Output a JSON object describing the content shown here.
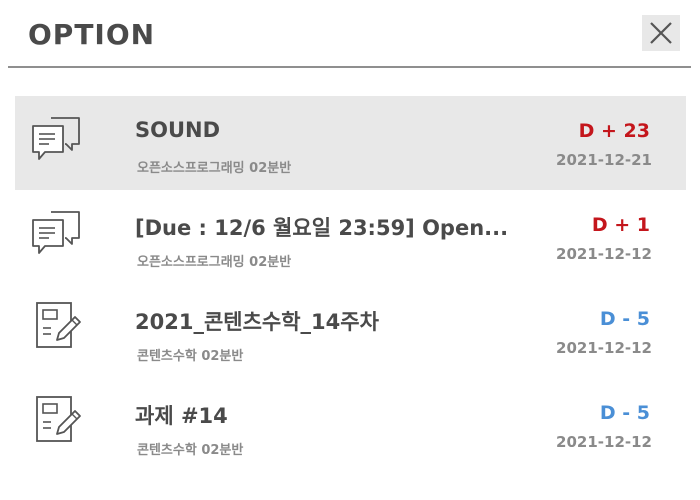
{
  "header": {
    "title": "OPTION",
    "close_icon": "close-icon"
  },
  "items": [
    {
      "icon": "chat-icon",
      "title": "SOUND",
      "course": "오픈소스프로그래밍 02분반",
      "dday": "D + 23",
      "dday_color": "#c4161c",
      "date": "2021-12-21",
      "selected": true
    },
    {
      "icon": "chat-icon",
      "title": "[Due : 12/6 월요일 23:59] Open...",
      "course": "오픈소스프로그래밍 02분반",
      "dday": "D + 1",
      "dday_color": "#c4161c",
      "date": "2021-12-12",
      "selected": false
    },
    {
      "icon": "document-edit-icon",
      "title": "2021_콘텐츠수학_14주차",
      "course": "콘텐츠수학 02분반",
      "dday": "D - 5",
      "dday_color": "#4a8fd6",
      "date": "2021-12-12",
      "selected": false
    },
    {
      "icon": "document-edit-icon",
      "title": "과제 #14",
      "course": "콘텐츠수학 02분반",
      "dday": "D - 5",
      "dday_color": "#4a8fd6",
      "date": "2021-12-12",
      "selected": false
    }
  ]
}
